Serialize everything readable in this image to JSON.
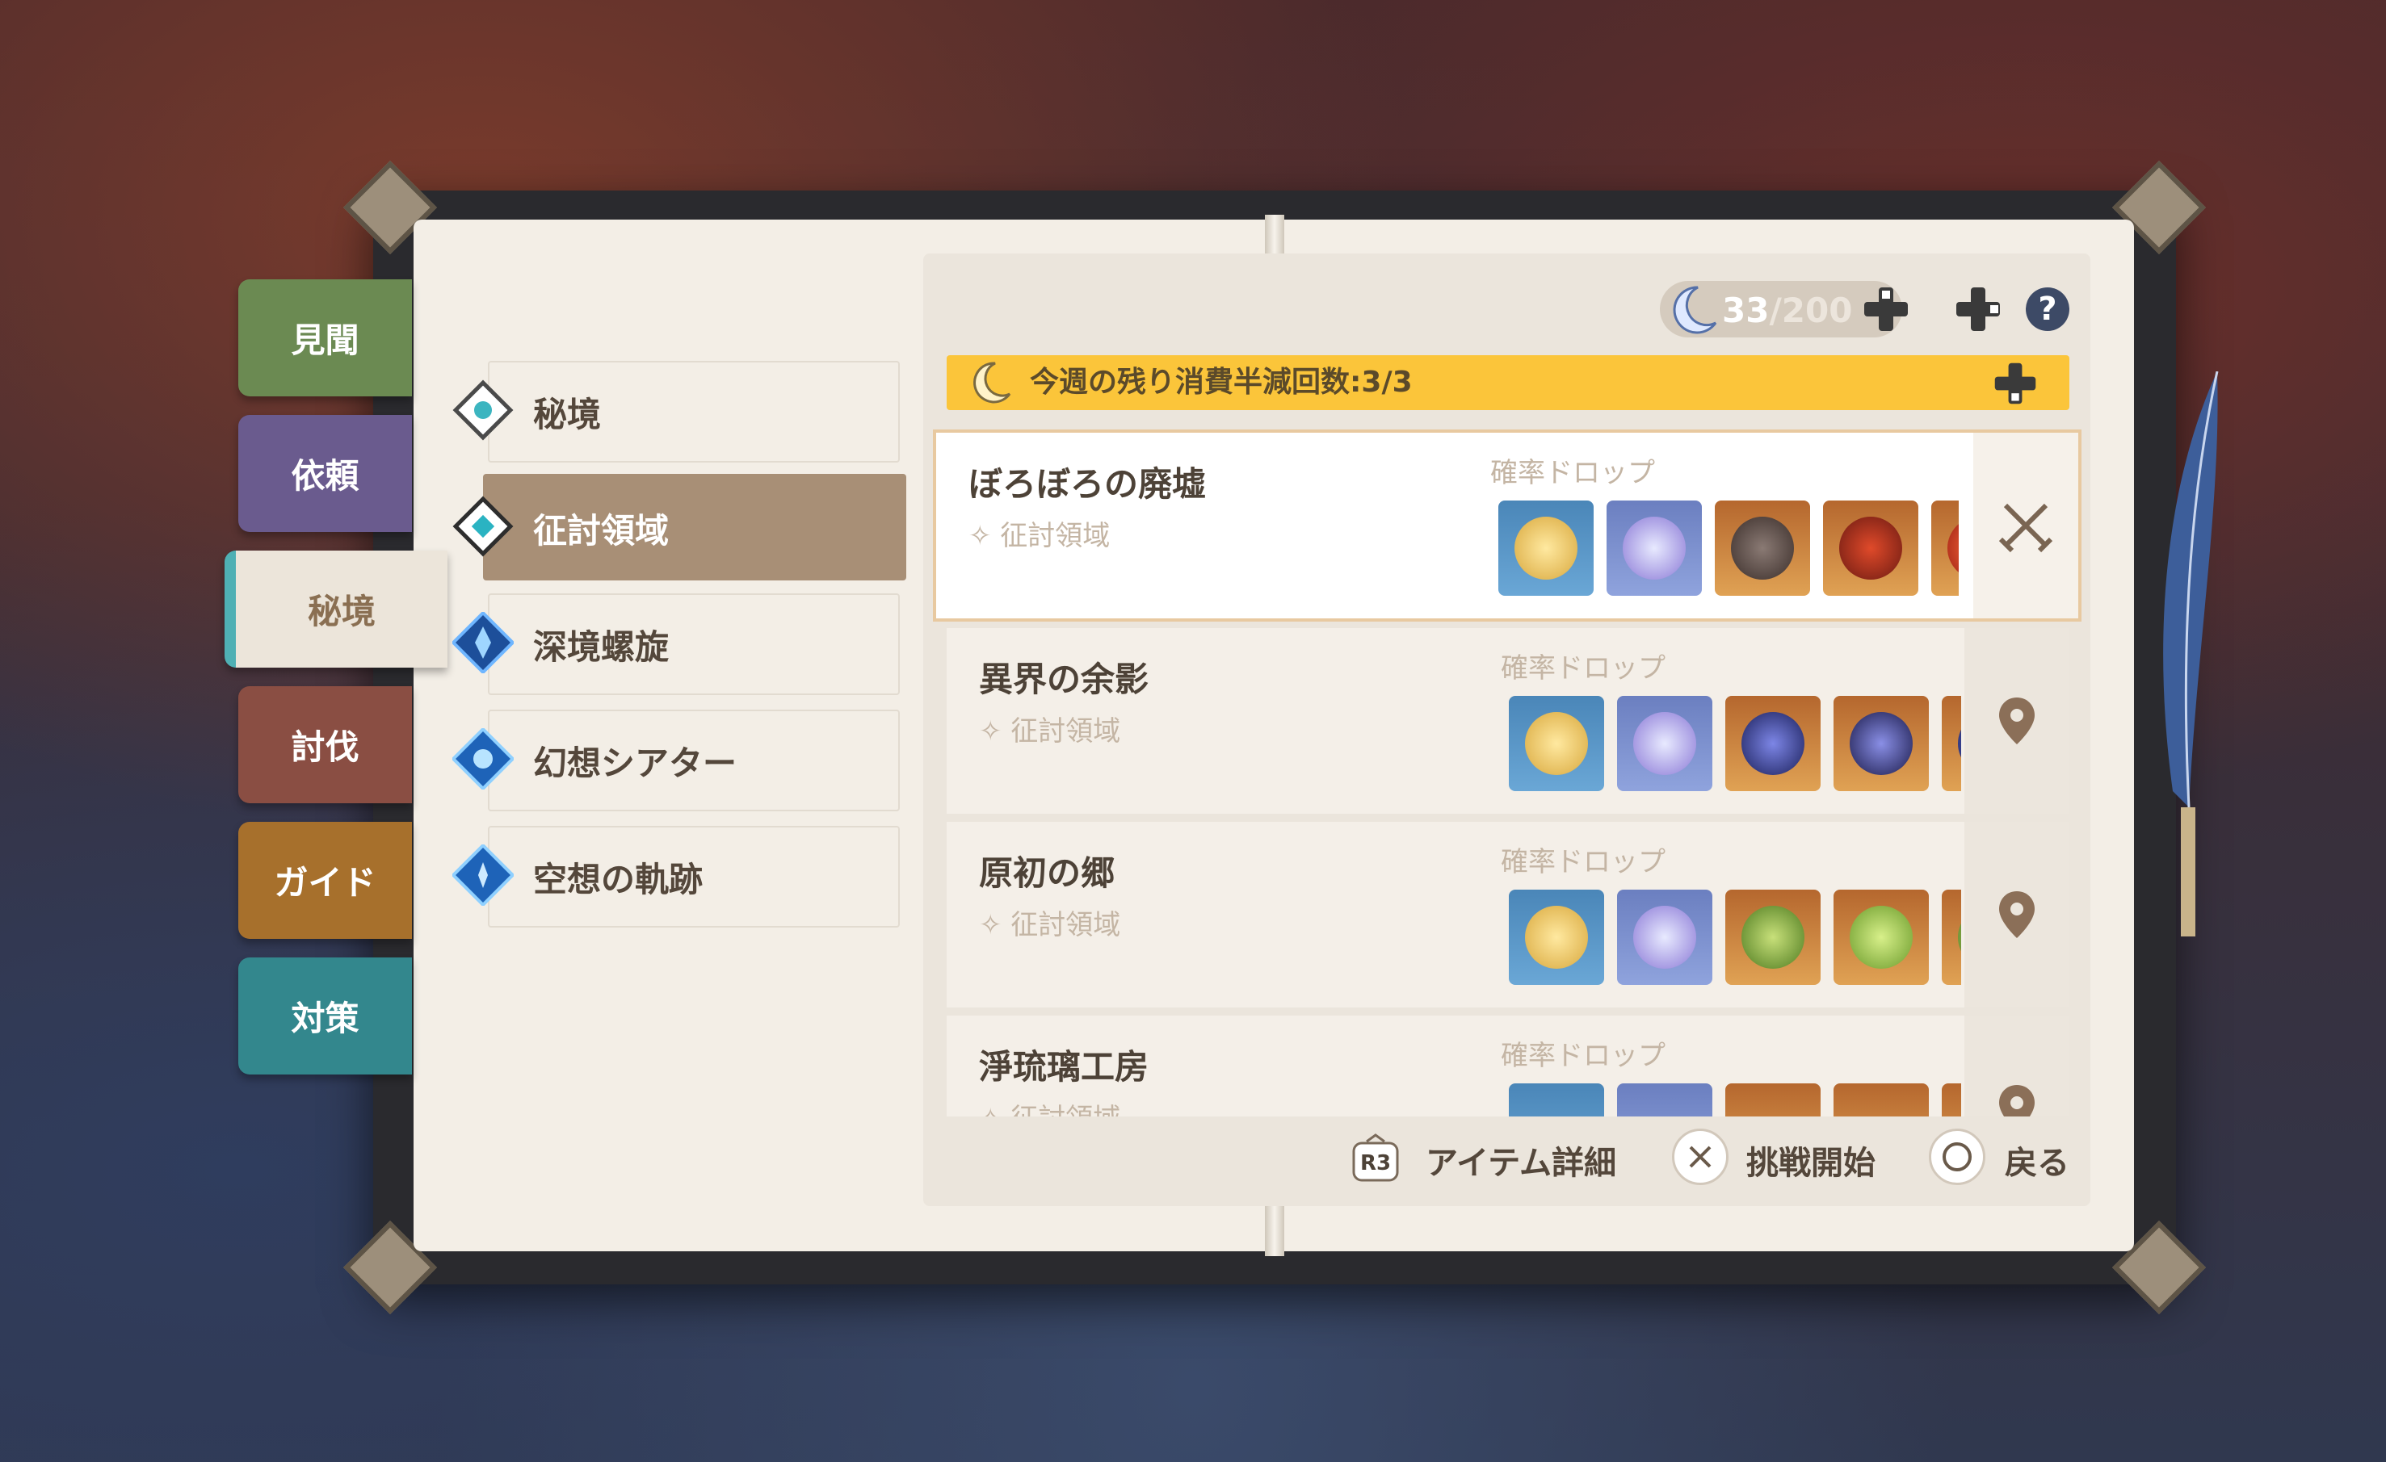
{
  "tabs": [
    {
      "label": "見聞",
      "color": "#6b8a52",
      "active": false
    },
    {
      "label": "依頼",
      "color": "#6a5b8e",
      "active": false
    },
    {
      "label": "秘境",
      "color": "#ece5da",
      "active": true
    },
    {
      "label": "討伐",
      "color": "#8a4e43",
      "active": false
    },
    {
      "label": "ガイド",
      "color": "#a7702c",
      "active": false
    },
    {
      "label": "対策",
      "color": "#33878d",
      "active": false
    }
  ],
  "categories": [
    {
      "label": "秘境",
      "selected": false
    },
    {
      "label": "征討領域",
      "selected": true
    },
    {
      "label": "深境螺旋",
      "selected": false
    },
    {
      "label": "幻想シアター",
      "selected": false
    },
    {
      "label": "空想の軌跡",
      "selected": false
    }
  ],
  "resin": {
    "current": "33",
    "max": "/200"
  },
  "banner": {
    "text": "今週の残り消費半減回数:3/3"
  },
  "domains": [
    {
      "name": "ぼろぼろの廃墟",
      "type": "征討領域",
      "drop_label": "確率ドロップ",
      "selected": true,
      "side_icon": "crossed-swords-icon"
    },
    {
      "name": "異界の余影",
      "type": "征討領域",
      "drop_label": "確率ドロップ",
      "selected": false,
      "side_icon": "location-pin-icon"
    },
    {
      "name": "原初の郷",
      "type": "征討領域",
      "drop_label": "確率ドロップ",
      "selected": false,
      "side_icon": "location-pin-icon"
    },
    {
      "name": "淨琉璃工房",
      "type": "征討領域",
      "drop_label": "確率ドロップ",
      "selected": false,
      "side_icon": "location-pin-icon"
    }
  ],
  "footer": {
    "r3_key": "R3",
    "item_detail": "アイテム詳細",
    "start_challenge": "挑戦開始",
    "back": "戻る"
  },
  "colors": {
    "accent": "#fbc53a",
    "selected_row": "#a88f76",
    "page": "#f3eee6"
  }
}
